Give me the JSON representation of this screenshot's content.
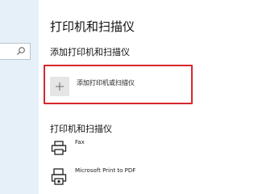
{
  "sidebar": {
    "search": {
      "icon": "search-icon"
    }
  },
  "page": {
    "title": "打印机和扫描仪"
  },
  "add_section": {
    "heading": "添加打印机和扫描仪",
    "add_button": {
      "icon": "plus-icon",
      "label": "添加打印机或扫描仪"
    }
  },
  "devices_section": {
    "heading": "打印机和扫描仪",
    "devices": [
      {
        "name": "Fax",
        "icon": "fax-printer-icon"
      },
      {
        "name": "Microsoft Print to PDF",
        "icon": "pdf-printer-icon"
      }
    ]
  },
  "colors": {
    "sidebar_bg": "#e6f0f8",
    "highlight": "#d8262c",
    "tile_bg": "#e5e5e5"
  }
}
